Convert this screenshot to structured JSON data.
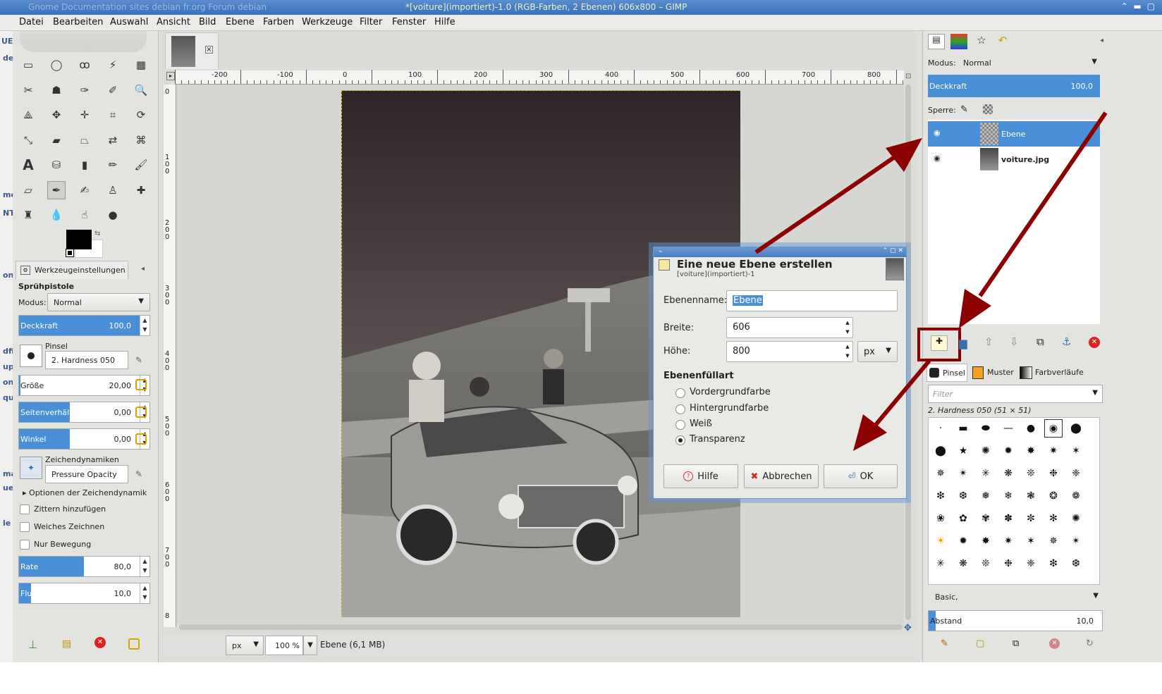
{
  "window": {
    "title": "*[voiture](importiert)-1.0 (RGB-Farben, 2 Ebenen) 606x800 – GIMP",
    "background_tabs": "Gnome    Documentation sites    debian fr.org    Forum debian"
  },
  "menu": [
    "Datei",
    "Bearbeiten",
    "Auswahl",
    "Ansicht",
    "Bild",
    "Ebene",
    "Farben",
    "Werkzeuge",
    "Filter",
    "Fenster",
    "Hilfe"
  ],
  "left_fragments": [
    "UE",
    "de",
    "me",
    "NT",
    "on",
    "dfi",
    "up",
    "on",
    "qu",
    "ma",
    "ue",
    "le"
  ],
  "toolbox": {
    "tools": [
      "rect-select-icon",
      "ellipse-select-icon",
      "lasso-icon",
      "fuzzy-select-icon",
      "color-select-icon",
      "scissors-icon",
      "foreground-select-icon",
      "paths-icon",
      "color-picker-icon",
      "zoom-icon",
      "measure-icon",
      "move-icon",
      "align-icon",
      "crop-icon",
      "rotate-icon",
      "scale-icon",
      "shear-icon",
      "perspective-icon",
      "flip-icon",
      "cage-icon",
      "text-icon",
      "bucket-fill-icon",
      "gradient-icon",
      "pencil-icon",
      "paintbrush-icon",
      "eraser-icon",
      "airbrush-icon",
      "ink-icon",
      "clone-icon",
      "heal-icon",
      "perspective-clone-icon",
      "blur-icon",
      "smudge-icon",
      "dodge-icon"
    ]
  },
  "tool_options": {
    "tab_label": "Werkzeugeinstellungen",
    "tool_name": "Sprühpistole",
    "mode_label": "Modus:",
    "mode_value": "Normal",
    "opacity_label": "Deckkraft",
    "opacity_value": "100,0",
    "opacity_fraction": 1.0,
    "brush_label": "Pinsel",
    "brush_value": "2. Hardness 050",
    "size_label": "Größe",
    "size_value": "20,00",
    "aspect_label": "Seitenverhältnis",
    "aspect_value": "0,00",
    "angle_label": "Winkel",
    "angle_value": "0,00",
    "dynamics_label": "Zeichendynamiken",
    "dynamics_value": "Pressure Opacity",
    "dynamics_options": "Optionen der Zeichendynamik",
    "jitter": "Zittern hinzufügen",
    "smooth": "Weiches Zeichnen",
    "motion_only": "Nur Bewegung",
    "rate_label": "Rate",
    "rate_value": "80,0",
    "flow_label": "Fluss",
    "flow_value": "10,0"
  },
  "image": {
    "ruler_labels": [
      "-200",
      "-100",
      "0",
      "100",
      "200",
      "300",
      "400",
      "500",
      "600",
      "700",
      "800"
    ],
    "ruler_left_labels": [
      "0",
      "1\n0\n0",
      "2\n0\n0",
      "3\n0\n0",
      "4\n0\n0",
      "5\n0\n0",
      "6\n0\n0",
      "7\n0\n0",
      "8"
    ]
  },
  "statusbar": {
    "unit": "px",
    "zoom": "100 %",
    "info": "Ebene (6,1 MB)"
  },
  "dialog": {
    "title": "Eine neue Ebene erstellen",
    "subtitle": "[voiture](importiert)-1",
    "name_label": "Ebenenname:",
    "name_value": "Ebene",
    "width_label": "Breite:",
    "width_value": "606",
    "height_label": "Höhe:",
    "height_value": "800",
    "unit": "px",
    "fill_label": "Ebenenfüllart",
    "fill_options": [
      "Vordergrundfarbe",
      "Hintergrundfarbe",
      "Weiß",
      "Transparenz"
    ],
    "fill_selected": "Transparenz",
    "help": "Hilfe",
    "cancel": "Abbrechen",
    "ok": "OK"
  },
  "layers_panel": {
    "mode_label": "Modus:",
    "mode_value": "Normal",
    "opacity_label": "Deckkraft",
    "opacity_value": "100,0",
    "lock_label": "Sperre:",
    "layers": [
      {
        "name": "Ebene",
        "selected": true
      },
      {
        "name": "voiture.jpg",
        "selected": false
      }
    ]
  },
  "brushes_panel": {
    "tabs": [
      "Pinsel",
      "Muster",
      "Farbverläufe"
    ],
    "filter_placeholder": "Filter",
    "current": "2. Hardness 050 (51 × 51)",
    "preset": "Basic,",
    "spacing_label": "Abstand",
    "spacing_value": "10,0"
  },
  "colors": {
    "accent": "#4a90d9",
    "arrow": "#8b0000",
    "titlebar": "#3b6fb6"
  }
}
